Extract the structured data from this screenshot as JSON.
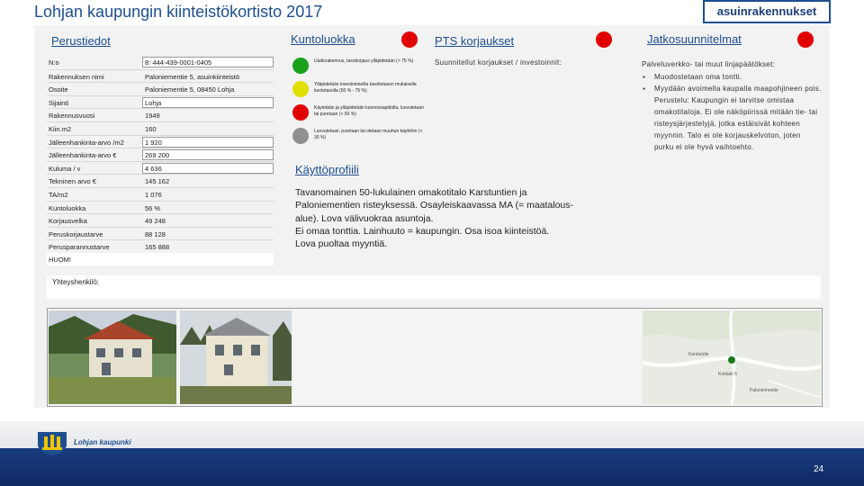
{
  "title": "Lohjan kaupungin kiinteistökortisto 2017",
  "category_tag": "asuinrakennukset",
  "headers": {
    "perustiedot": "Perustiedot",
    "kuntoluokka": "Kuntoluokka",
    "pts": "PTS korjaukset",
    "jatko": "Jatkosuunnitelmat",
    "kayttoprofiili": "Käyttöprofiili"
  },
  "status_colors": {
    "kuntoluokka": "#e00000",
    "pts": "#e00000",
    "jatko": "#e00000"
  },
  "perustiedot": [
    {
      "label": "N:o",
      "value": "8: 444-439-0001-0405"
    },
    {
      "label": "Rakennuksen nimi",
      "value": "Paloniementie 5, asuinkiinteistö"
    },
    {
      "label": "Osoite",
      "value": "Paloniementie 5, 08450 Lohja"
    },
    {
      "label": "Sijainti",
      "value": "Lohja"
    },
    {
      "label": "Rakennusvuosi",
      "value": "1949"
    },
    {
      "label": "Kiin.m2",
      "value": "160"
    },
    {
      "label": "Jälleenhankinta-arvo /m2",
      "value": "1 920"
    },
    {
      "label": "Jälleenhankinta-arvo €",
      "value": "269 200"
    },
    {
      "label": "Kuluma / v",
      "value": "4 636"
    },
    {
      "label": "Tekninen arvo €",
      "value": "145 162"
    },
    {
      "label": "TA/m2",
      "value": "1 076"
    },
    {
      "label": "Kuntoluokka",
      "value": "56 %"
    },
    {
      "label": "Korjausvelka",
      "value": "49 248"
    },
    {
      "label": "Peruskorjaustarve",
      "value": "88 128"
    },
    {
      "label": "Perusparannustarve",
      "value": "165 888"
    }
  ],
  "huom_label": "HUOM!",
  "kuntoluokka_legend": [
    {
      "color": "#1aa01a",
      "text": "Uudisrakennus, tasokorjaus ylläpidetään (> 75 %)"
    },
    {
      "color": "#e0e000",
      "text": "Ylläpidetään investoinneilla tavoitetason mukaisella kuntotasolla (50 % - 75 %)"
    },
    {
      "color": "#e00000",
      "text": "Käytetään ja ylläpidetään kunnossapidolla, luovutetaan tai puretaan (< 50 %)"
    },
    {
      "color": "#909090",
      "text": "Luovutetaan, puretaan tai otetaan muuhun käyttöön (< 30 %)"
    }
  ],
  "pts_text": "Suunnitellut korjaukset / investoinnit:",
  "jatko_intro": "Palveluverkko- tai muut linjapäätökset:",
  "jatko_items": [
    "Muodostetaan oma tontti.",
    "Myydään avoimella kaupalla maapohjineen pois. Perustelu: Kaupungin ei tarvitse omistaa omakotitaloja. Ei ole näköpiirissä mitään tie- tai risteysjärjestelyjä, jotka estäisivät kohteen myynnin. Talo ei ole korjauskelvoton, joten purku ei ole hyvä vaihtoehto."
  ],
  "kayttoprofiili_lines": [
    "Tavanomainen 50-lukulainen omakotitalo Karstuntien ja",
    "Paloniementien risteyksessä. Osayleiskaavassa MA (= maatalous-",
    "alue). Lova välivuokraa asuntoja.",
    "Ei omaa tonttia. Lainhuuto = kaupungin. Osa isoa kiinteistöä.",
    "Lova puoltaa myyntiä."
  ],
  "yhteyshenkilo_label": "Yhteyshenkilö:",
  "map_labels": {
    "road": "Karstuntie",
    "house": "Kotitalo 5",
    "street": "Paloniementie"
  },
  "footer_logo_text": "Lohjan kaupunki",
  "page_number": "24"
}
